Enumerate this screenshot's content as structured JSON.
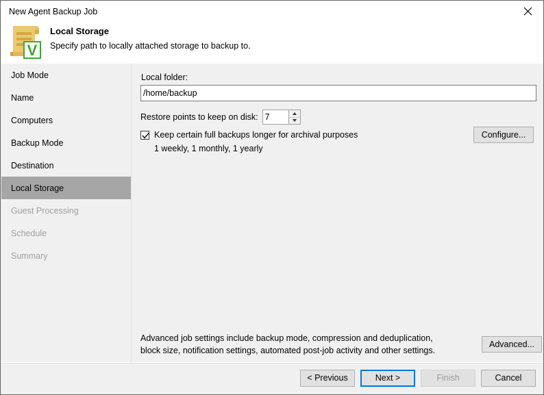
{
  "window": {
    "title": "New Agent Backup Job",
    "close_icon": "close-icon"
  },
  "header": {
    "title": "Local Storage",
    "subtitle": "Specify path to locally attached storage to backup to.",
    "icon": "backup-job-scroll-icon"
  },
  "sidebar": {
    "items": [
      {
        "label": "Job Mode",
        "state": "normal"
      },
      {
        "label": "Name",
        "state": "normal"
      },
      {
        "label": "Computers",
        "state": "normal"
      },
      {
        "label": "Backup Mode",
        "state": "normal"
      },
      {
        "label": "Destination",
        "state": "normal"
      },
      {
        "label": "Local Storage",
        "state": "active"
      },
      {
        "label": "Guest Processing",
        "state": "disabled"
      },
      {
        "label": "Schedule",
        "state": "disabled"
      },
      {
        "label": "Summary",
        "state": "disabled"
      }
    ]
  },
  "main": {
    "local_folder_label": "Local folder:",
    "local_folder_value": "/home/backup",
    "local_folder_placeholder": "",
    "restore_points_label": "Restore points to keep on disk:",
    "restore_points_value": "7",
    "keep_full_backups_label": "Keep certain full backups longer for archival purposes",
    "keep_full_backups_checked": true,
    "retention_note": "1 weekly, 1 monthly, 1 yearly",
    "configure_button": "Configure...",
    "advanced_text_line1": "Advanced job settings include backup mode, compression and deduplication,",
    "advanced_text_line2": "block size, notification settings, automated post-job activity and other settings.",
    "advanced_button": "Advanced..."
  },
  "footer": {
    "previous_button": "< Previous",
    "next_button": "Next >",
    "finish_button": "Finish",
    "cancel_button": "Cancel"
  },
  "colors": {
    "accent_focus": "#0078d7",
    "sidebar_active_bg": "#a6a6a6",
    "panel_bg": "#f0f0f0",
    "icon_paper": "#e8c46a",
    "icon_paper_dark": "#cfa23f",
    "icon_v_green": "#3fa535"
  }
}
